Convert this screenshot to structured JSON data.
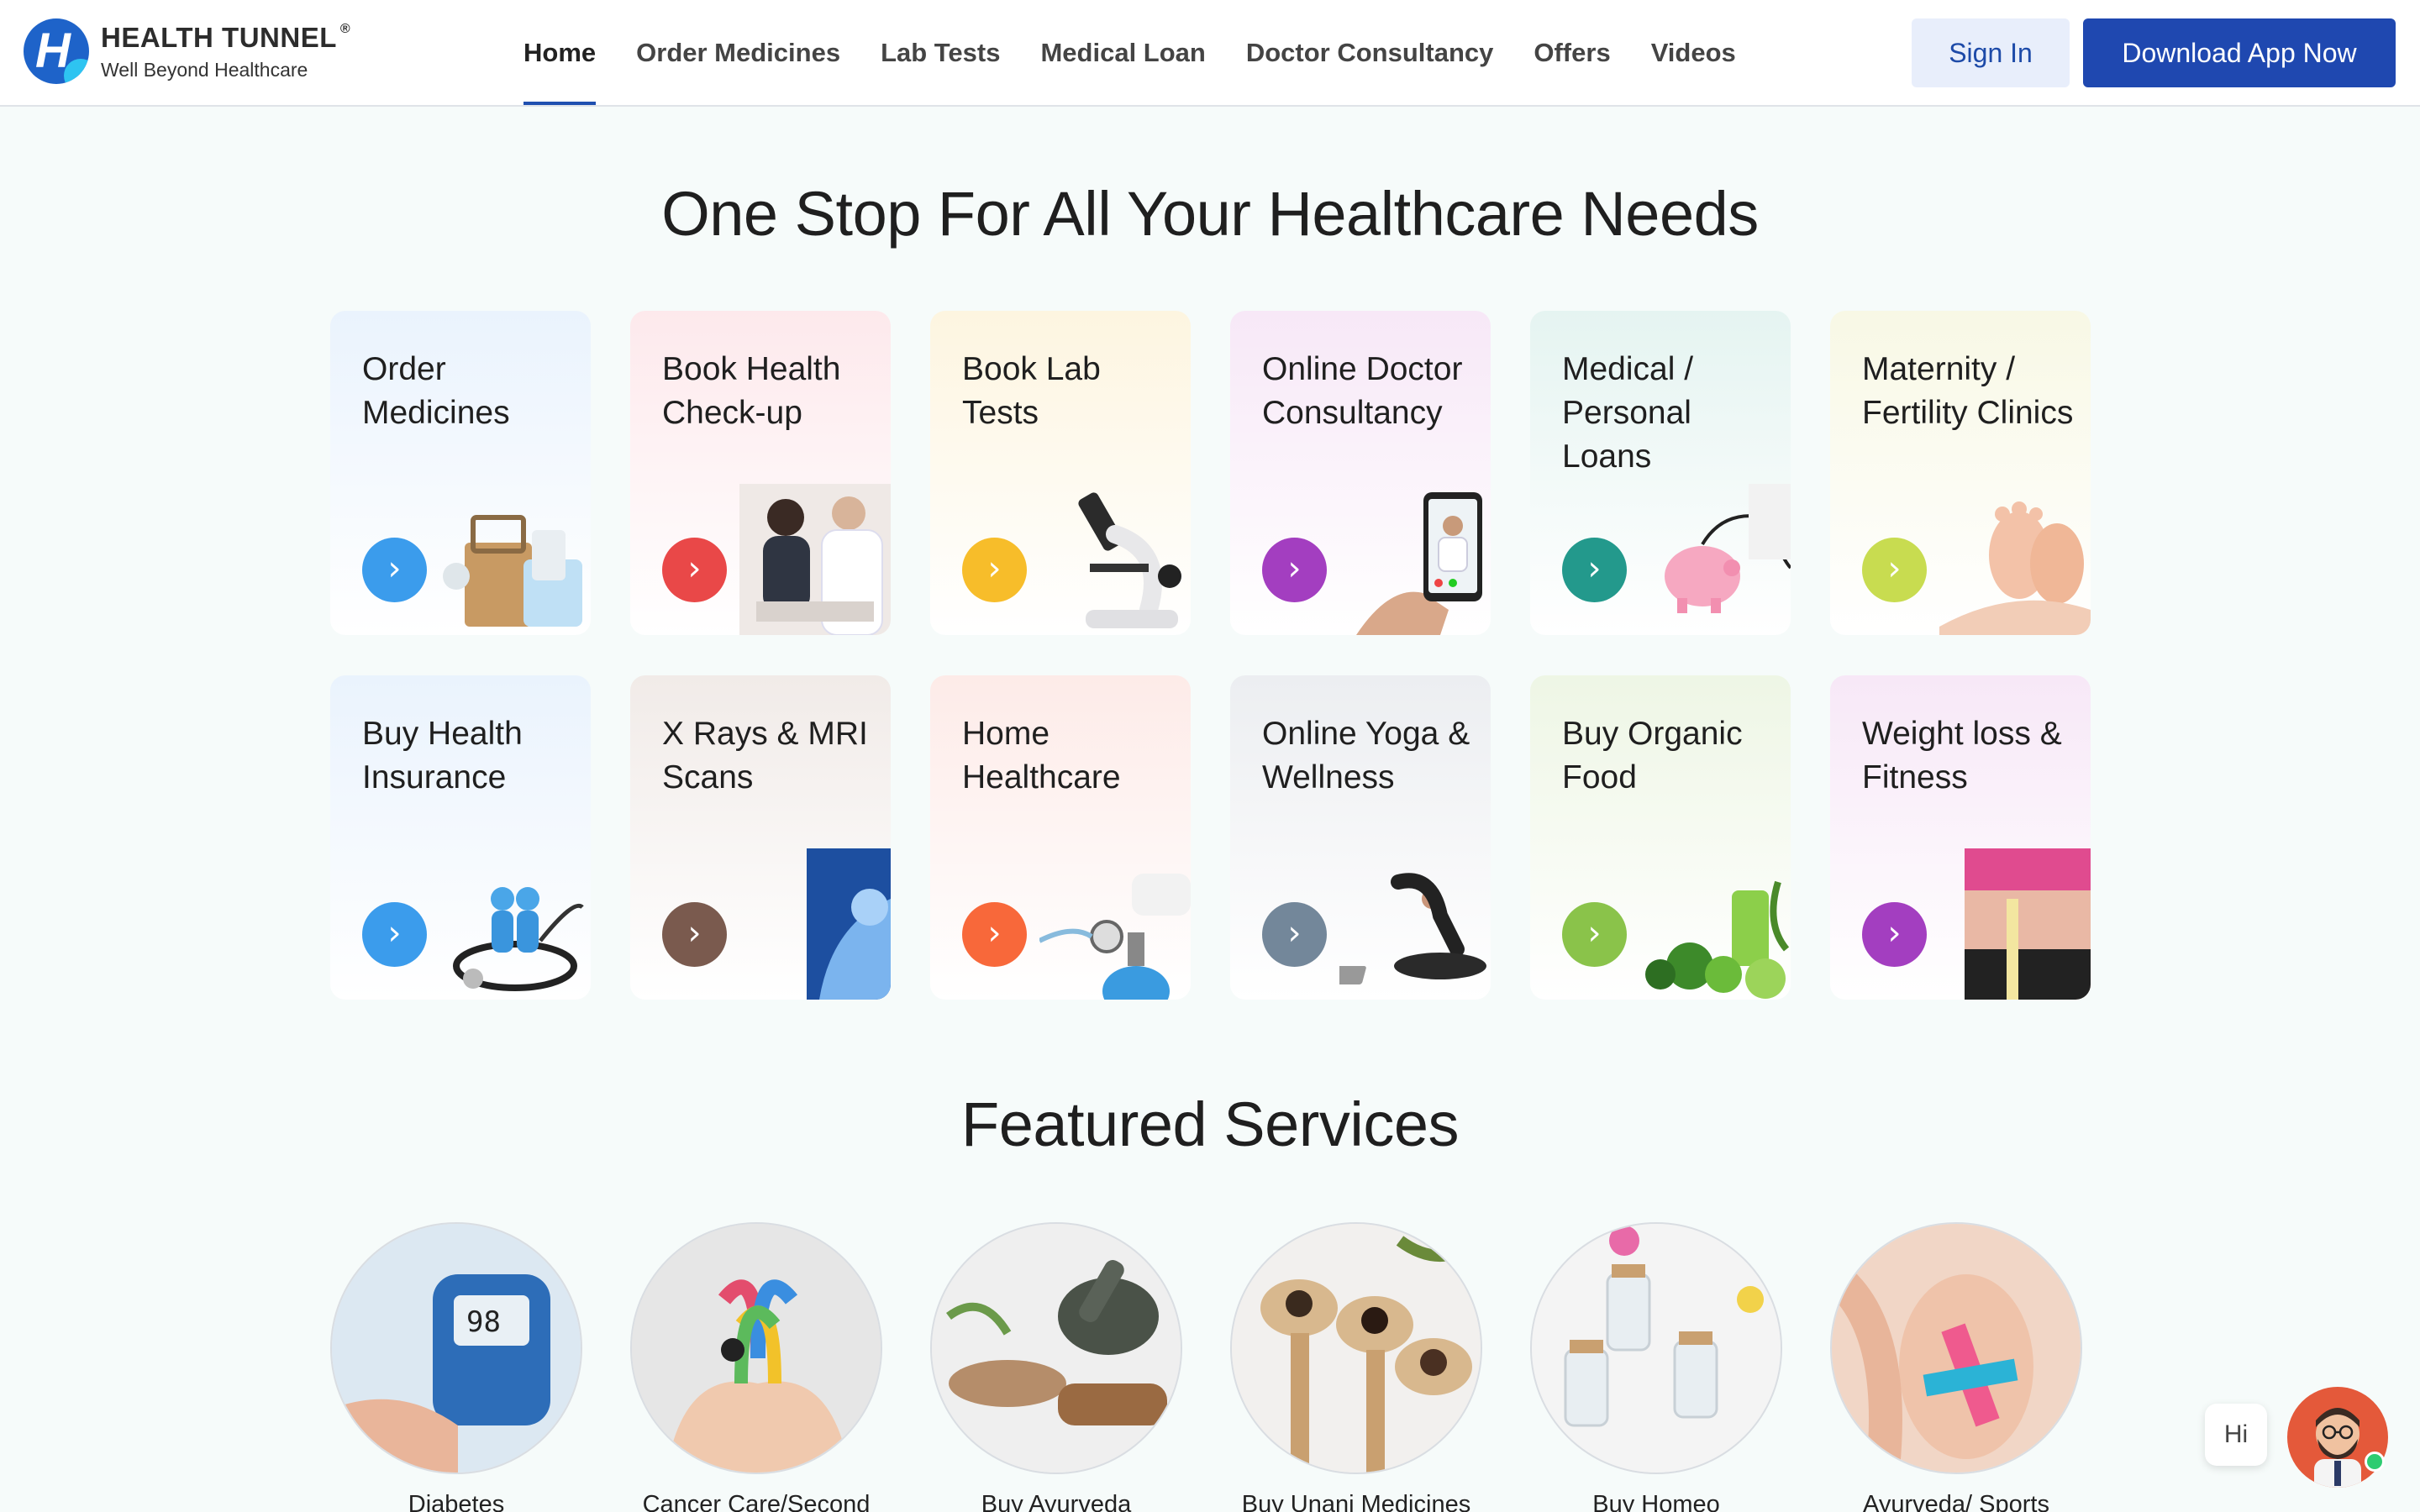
{
  "header": {
    "brand_name": "HEALTH TUNNEL",
    "brand_reg": "®",
    "brand_tagline": "Well Beyond Healthcare",
    "logo_letter": "H",
    "nav": [
      {
        "label": "Home",
        "active": true
      },
      {
        "label": "Order Medicines"
      },
      {
        "label": "Lab Tests"
      },
      {
        "label": "Medical Loan"
      },
      {
        "label": "Doctor Consultancy"
      },
      {
        "label": "Offers"
      },
      {
        "label": "Videos"
      }
    ],
    "signin_label": "Sign In",
    "download_label": "Download App Now"
  },
  "hero": {
    "title": "One Stop For All Your Healthcare Needs"
  },
  "services": [
    {
      "label": "Order Medicines",
      "arrow_color": "#3b9cec",
      "bg": "#eaf3fd",
      "icon": "medicine-bag-icon"
    },
    {
      "label": "Book Health Check-up",
      "arrow_color": "#e94848",
      "bg": "#fde9ec",
      "icon": "doctor-patient-icon"
    },
    {
      "label": "Book Lab Tests",
      "arrow_color": "#f7bd2a",
      "bg": "#fdf5e0",
      "icon": "microscope-icon"
    },
    {
      "label": "Online Doctor Consultancy",
      "arrow_color": "#a33ec0",
      "bg": "#f7e8f7",
      "icon": "phone-doctor-icon"
    },
    {
      "label": "Medical / Personal Loans",
      "arrow_color": "#23998c",
      "bg": "#e5f4f1",
      "icon": "piggy-bank-icon"
    },
    {
      "label": "Maternity / Fertility Clinics",
      "arrow_color": "#c8dc50",
      "bg": "#f8f8e5",
      "icon": "baby-feet-icon"
    },
    {
      "label": "Buy Health Insurance",
      "arrow_color": "#3b9cec",
      "bg": "#eaf3fd",
      "icon": "family-stethoscope-icon"
    },
    {
      "label": "X Rays & MRI Scans",
      "arrow_color": "#7a5a4e",
      "bg": "#f1ebe8",
      "icon": "xray-shoulder-icon"
    },
    {
      "label": "Home Healthcare",
      "arrow_color": "#f8683a",
      "bg": "#fdebe8",
      "icon": "oxygen-cylinder-icon"
    },
    {
      "label": "Online Yoga & Wellness",
      "arrow_color": "#73879a",
      "bg": "#eceef1",
      "icon": "yoga-icon"
    },
    {
      "label": "Buy Organic Food",
      "arrow_color": "#8ac34a",
      "bg": "#eef6e5",
      "icon": "vegetables-icon"
    },
    {
      "label": "Weight loss & Fitness",
      "arrow_color": "#a33ec0",
      "bg": "#f7e8f7",
      "icon": "measuring-tape-icon"
    }
  ],
  "featured": {
    "title": "Featured Services",
    "items": [
      {
        "label": "Diabetes",
        "icon": "glucometer-icon"
      },
      {
        "label": "Cancer Care/Second",
        "icon": "ribbons-icon"
      },
      {
        "label": "Buy Ayurveda",
        "icon": "mortar-pestle-icon"
      },
      {
        "label": "Buy Unani Medicines",
        "icon": "spoons-herbs-icon"
      },
      {
        "label": "Buy Homeo",
        "icon": "pill-bottles-icon"
      },
      {
        "label": "Ayurveda/ Sports",
        "icon": "knee-tape-icon"
      }
    ]
  },
  "chat": {
    "greeting": "Hi",
    "icon": "support-avatar-icon"
  }
}
